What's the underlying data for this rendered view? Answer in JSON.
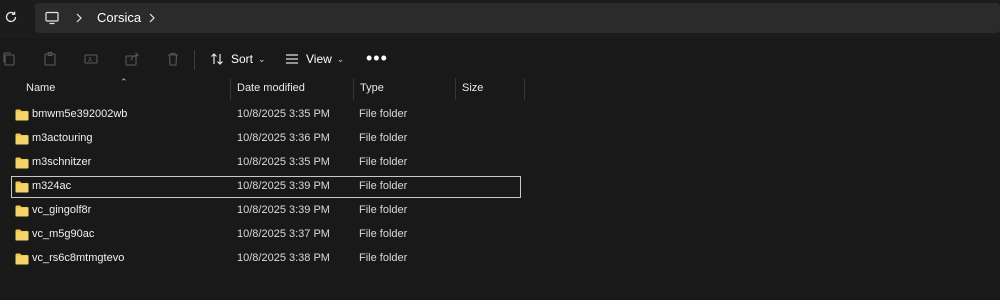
{
  "address": {
    "location": "Corsica"
  },
  "toolbar": {
    "sort_label": "Sort",
    "view_label": "View",
    "more_label": "•••"
  },
  "columns": {
    "name": "Name",
    "date": "Date modified",
    "type": "Type",
    "size": "Size"
  },
  "files": [
    {
      "name": "bmwm5e392002wb",
      "date": "10/8/2025 3:35 PM",
      "type": "File folder"
    },
    {
      "name": "m3actouring",
      "date": "10/8/2025 3:36 PM",
      "type": "File folder"
    },
    {
      "name": "m3schnitzer",
      "date": "10/8/2025 3:35 PM",
      "type": "File folder"
    },
    {
      "name": "m324ac",
      "date": "10/8/2025 3:39 PM",
      "type": "File folder"
    },
    {
      "name": "vc_gingolf8r",
      "date": "10/8/2025 3:39 PM",
      "type": "File folder"
    },
    {
      "name": "vc_m5g90ac",
      "date": "10/8/2025 3:37 PM",
      "type": "File folder"
    },
    {
      "name": "vc_rs6c8mtmgtevo",
      "date": "10/8/2025 3:38 PM",
      "type": "File folder"
    }
  ],
  "selected_index": 3,
  "colors": {
    "background": "#191919",
    "address_box": "#2b2b2b",
    "folder": "#f2c94c",
    "selection_border": "#c8c8c8"
  }
}
